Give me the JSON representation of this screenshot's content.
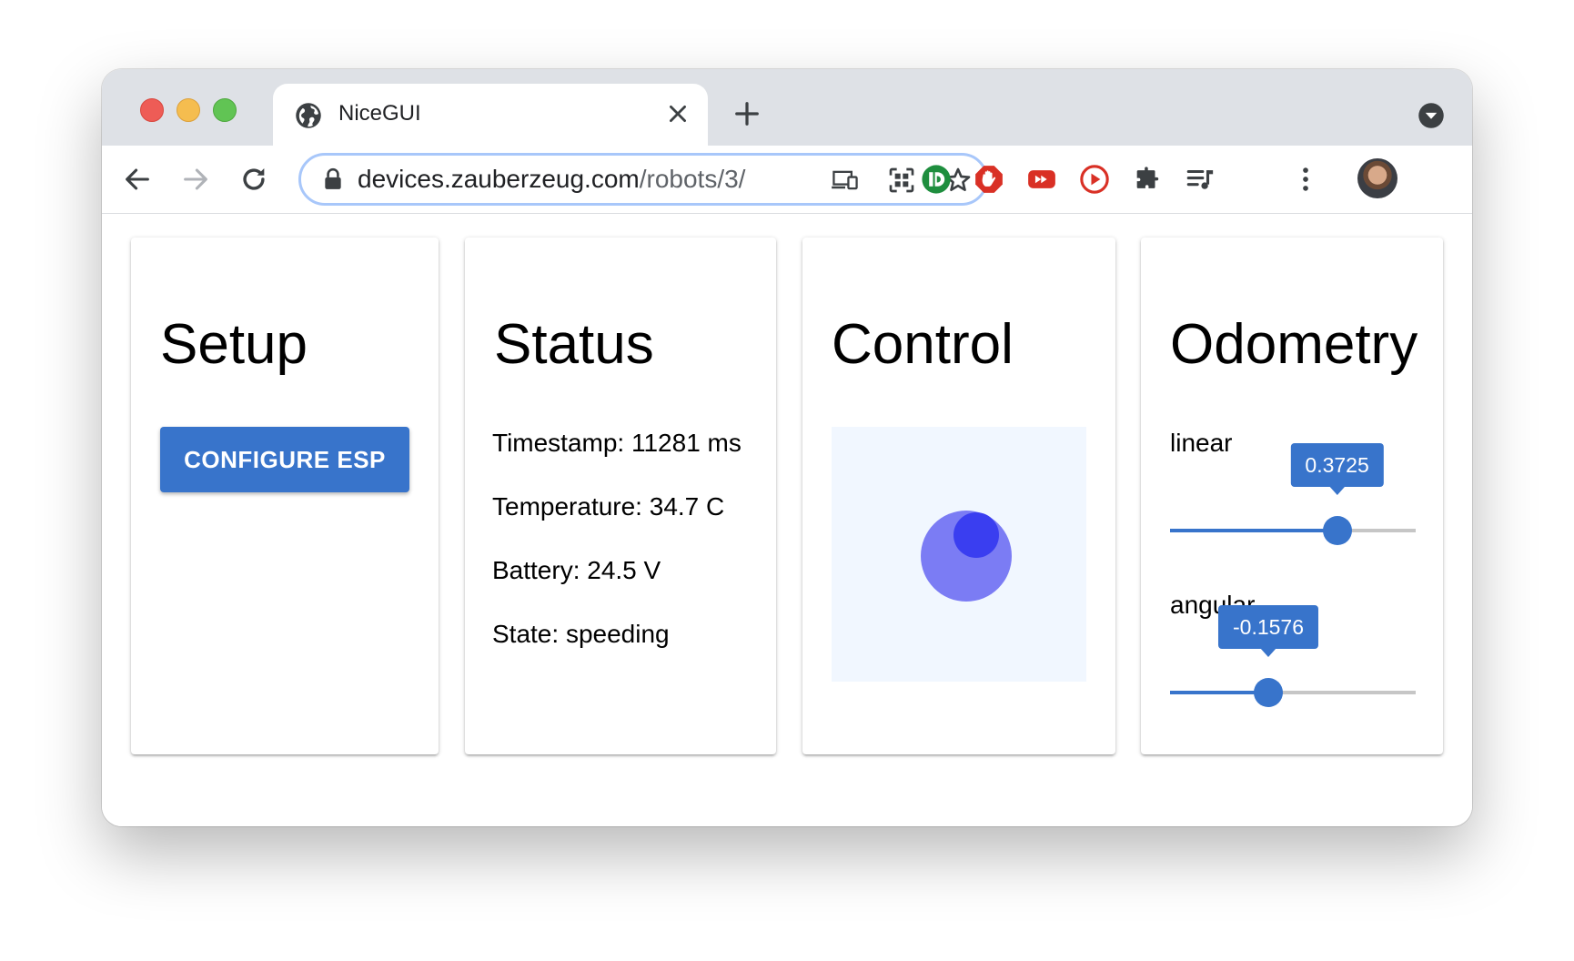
{
  "browser": {
    "tab_title": "NiceGUI",
    "url_host": "devices.zauberzeug.com",
    "url_path": "/robots/3/"
  },
  "extensions": [
    {
      "icon": "dashlane-icon",
      "color": "#1e8e3e"
    },
    {
      "icon": "adblock-icon",
      "color": "#d93025"
    },
    {
      "icon": "youtube-ff-icon",
      "color": "#d93025"
    },
    {
      "icon": "play-record-icon",
      "color": "#d93025"
    },
    {
      "icon": "extensions-puzzle-icon",
      "color": "#5f6368"
    },
    {
      "icon": "media-queue-icon",
      "color": "#5f6368"
    }
  ],
  "cards": {
    "setup": {
      "title": "Setup",
      "button_label": "CONFIGURE ESP"
    },
    "status": {
      "title": "Status",
      "lines": [
        "Timestamp: 11281 ms",
        "Temperature: 34.7 C",
        "Battery: 24.5 V",
        "State: speeding"
      ]
    },
    "control": {
      "title": "Control"
    },
    "odometry": {
      "title": "Odometry",
      "linear": {
        "label": "linear",
        "value": "0.3725",
        "fraction": 0.68
      },
      "angular": {
        "label": "angular",
        "value": "-0.1576",
        "fraction": 0.4
      }
    }
  },
  "colors": {
    "primary": "#3874cb",
    "joystick_base": "#7b7cf4",
    "joystick_knob": "#3a3ef0",
    "joystick_area": "#f1f7ff"
  }
}
